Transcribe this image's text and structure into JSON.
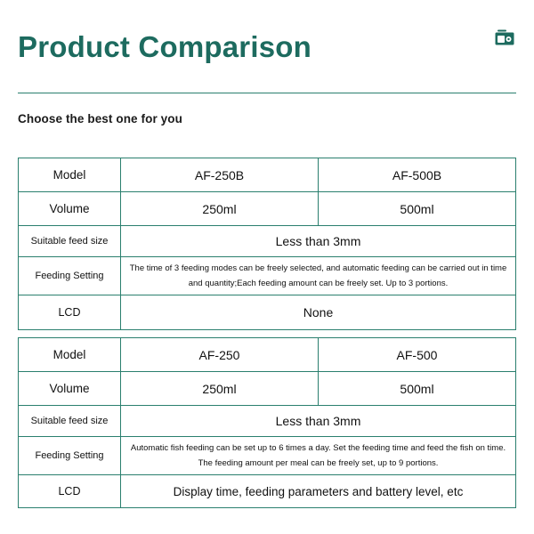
{
  "header": {
    "title": "Product Comparison",
    "icon": "radio-device-icon",
    "accent_color": "#1d6b5f",
    "rule_color": "#2a7f6e"
  },
  "subtitle": "Choose the best one for you",
  "tables": [
    {
      "name": "table-af-b-series",
      "rows": [
        {
          "label": "Model",
          "type": "split",
          "values": [
            "AF-250B",
            "AF-500B"
          ]
        },
        {
          "label": "Volume",
          "type": "split",
          "values": [
            "250ml",
            "500ml"
          ]
        },
        {
          "label": "Suitable feed size",
          "type": "merged",
          "value": "Less than 3mm"
        },
        {
          "label": "Feeding Setting",
          "type": "merged-paragraph",
          "value": "The time of 3 feeding modes can be freely selected, and automatic feeding can be carried out in time and quantity;Each feeding amount can be freely set. Up to 3 portions."
        },
        {
          "label": "LCD",
          "type": "merged",
          "value": "None"
        }
      ]
    },
    {
      "name": "table-af-series",
      "rows": [
        {
          "label": "Model",
          "type": "split",
          "values": [
            "AF-250",
            "AF-500"
          ]
        },
        {
          "label": "Volume",
          "type": "split",
          "values": [
            "250ml",
            "500ml"
          ]
        },
        {
          "label": "Suitable feed size",
          "type": "merged",
          "value": "Less than 3mm"
        },
        {
          "label": "Feeding Setting",
          "type": "merged-paragraph",
          "value": "Automatic fish feeding can be set up to 6 times a day. Set the feeding time and feed the fish on time. The feeding amount per meal can be freely set, up to 9 portions."
        },
        {
          "label": "LCD",
          "type": "merged",
          "value": "Display time, feeding parameters and battery level, etc"
        }
      ]
    }
  ]
}
